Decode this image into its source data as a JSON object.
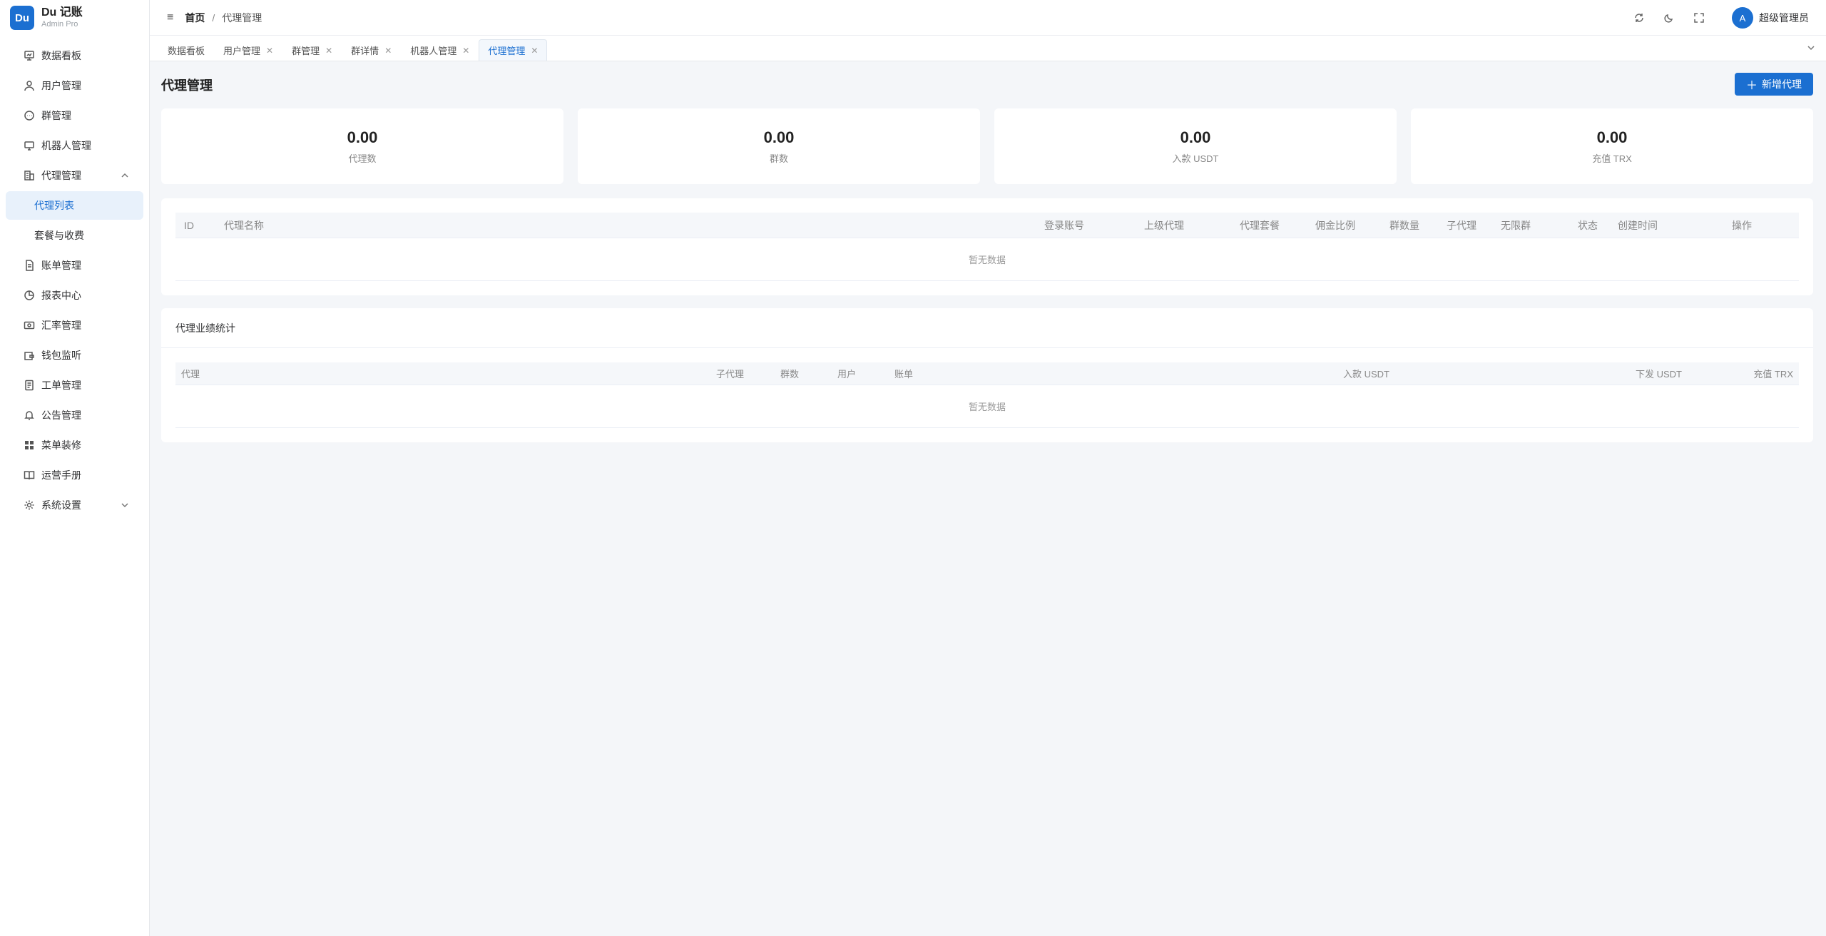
{
  "brand": {
    "logo": "Du",
    "title": "Du 记账",
    "subtitle": "Admin Pro"
  },
  "sidebar": {
    "items": [
      {
        "label": "数据看板",
        "icon": "dashboard-icon"
      },
      {
        "label": "用户管理",
        "icon": "user-icon"
      },
      {
        "label": "群管理",
        "icon": "chat-icon"
      },
      {
        "label": "机器人管理",
        "icon": "monitor-icon"
      },
      {
        "label": "代理管理",
        "icon": "building-icon",
        "expanded": true
      },
      {
        "label": "代理列表",
        "sub": true,
        "active": true
      },
      {
        "label": "套餐与收费",
        "sub": true
      },
      {
        "label": "账单管理",
        "icon": "document-icon"
      },
      {
        "label": "报表中心",
        "icon": "pie-chart-icon"
      },
      {
        "label": "汇率管理",
        "icon": "money-icon"
      },
      {
        "label": "钱包监听",
        "icon": "wallet-icon"
      },
      {
        "label": "工单管理",
        "icon": "ticket-icon"
      },
      {
        "label": "公告管理",
        "icon": "bell-icon"
      },
      {
        "label": "菜单装修",
        "icon": "grid-icon"
      },
      {
        "label": "运营手册",
        "icon": "book-icon"
      },
      {
        "label": "系统设置",
        "icon": "gear-icon"
      }
    ]
  },
  "header": {
    "breadcrumb_home": "首页",
    "breadcrumb_sep": "/",
    "breadcrumb_current": "代理管理",
    "avatar_letter": "A",
    "username": "超级管理员"
  },
  "tabs": [
    {
      "label": "数据看板",
      "closable": false
    },
    {
      "label": "用户管理",
      "closable": true
    },
    {
      "label": "群管理",
      "closable": true
    },
    {
      "label": "群详情",
      "closable": true
    },
    {
      "label": "机器人管理",
      "closable": true
    },
    {
      "label": "代理管理",
      "closable": true,
      "active": true
    }
  ],
  "page": {
    "title": "代理管理",
    "add_button": "新增代理"
  },
  "stats": [
    {
      "value": "0.00",
      "label": "代理数"
    },
    {
      "value": "0.00",
      "label": "群数"
    },
    {
      "value": "0.00",
      "label": "入款 USDT"
    },
    {
      "value": "0.00",
      "label": "充值 TRX"
    }
  ],
  "agent_table": {
    "columns": [
      "ID",
      "代理名称",
      "登录账号",
      "上级代理",
      "代理套餐",
      "佣金比例",
      "群数量",
      "子代理",
      "无限群",
      "状态",
      "创建时间",
      "操作"
    ],
    "empty_text": "暂无数据"
  },
  "performance": {
    "title": "代理业绩统计",
    "columns": [
      "代理",
      "子代理",
      "群数",
      "用户",
      "账单",
      "入款 USDT",
      "下发 USDT",
      "充值 TRX"
    ],
    "empty_text": "暂无数据"
  },
  "colors": {
    "primary": "#1b6fd1",
    "background": "#f4f6f9"
  }
}
